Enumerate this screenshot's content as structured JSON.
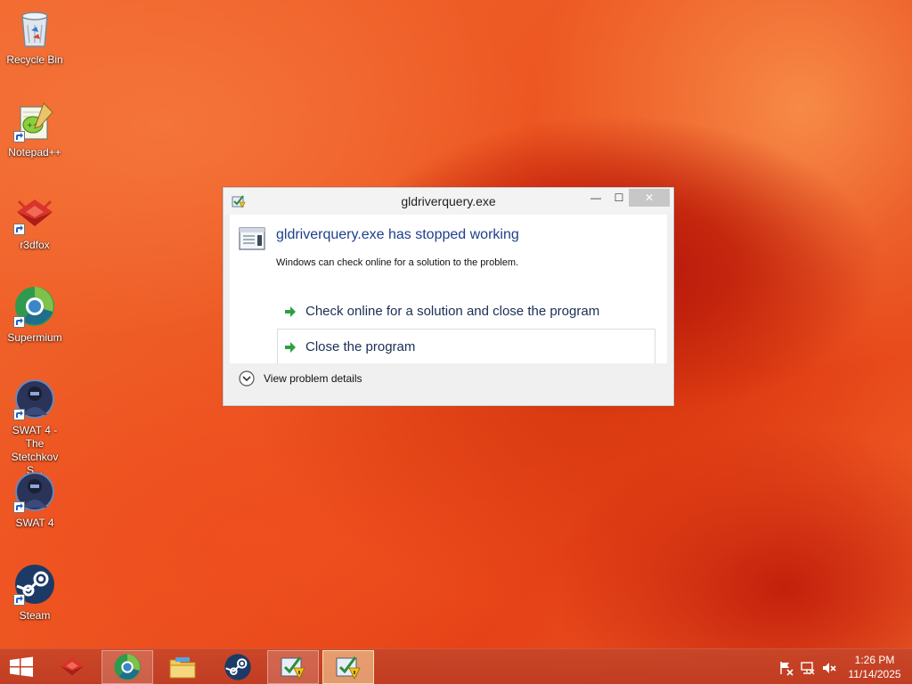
{
  "desktop_icons": [
    {
      "label": "Recycle Bin",
      "icon": "recycle-bin-icon"
    },
    {
      "label": "Notepad++",
      "icon": "notepad-plus-plus-icon"
    },
    {
      "label": "r3dfox",
      "icon": "r3dfox-icon"
    },
    {
      "label": "Supermium",
      "icon": "supermium-icon"
    },
    {
      "label": "SWAT 4 - The Stetchkov S...",
      "icon": "swat4-expansion-icon"
    },
    {
      "label": "SWAT 4",
      "icon": "swat4-icon"
    },
    {
      "label": "Steam",
      "icon": "steam-icon"
    }
  ],
  "dialog": {
    "title": "gldriverquery.exe",
    "heading": "gldriverquery.exe has stopped working",
    "description": "Windows can check online for a solution to the problem.",
    "options": [
      {
        "label": "Check online for a solution and close the program"
      },
      {
        "label": "Close the program"
      }
    ],
    "details_label": "View problem details",
    "window_buttons": {
      "minimize": "—",
      "maximize": "☐",
      "close": "✕"
    }
  },
  "taskbar": {
    "items": [
      {
        "icon": "r3dfox-icon",
        "state": "pinned"
      },
      {
        "icon": "supermium-icon",
        "state": "open"
      },
      {
        "icon": "file-explorer-icon",
        "state": "pinned"
      },
      {
        "icon": "steam-icon",
        "state": "pinned"
      },
      {
        "icon": "error-report-icon",
        "state": "open"
      },
      {
        "icon": "error-report-icon",
        "state": "active"
      }
    ],
    "tray_icons": [
      "action-center-flag-icon",
      "network-icon",
      "volume-muted-icon"
    ],
    "clock": {
      "time": "1:26 PM",
      "date": "11/14/2025"
    }
  },
  "colors": {
    "wallpaper": "#ec5420",
    "dialog_heading": "#1e3f8a",
    "arrow_green": "#2ea043"
  }
}
